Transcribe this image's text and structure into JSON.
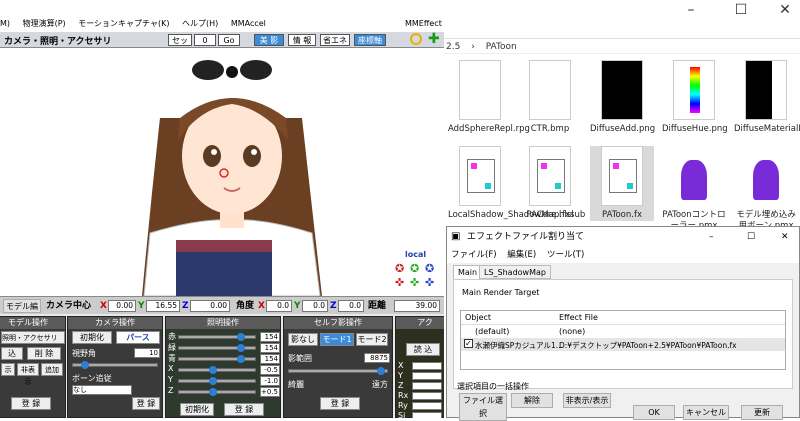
{
  "mmd": {
    "menu": [
      "M)",
      "物理演算(P)",
      "モーションキャプチャ(K)",
      "ヘルプ(H)",
      "MMAccel",
      "MMEffect"
    ],
    "viewport_title": "カメラ・照明・アクセサリ",
    "set_label": "セット",
    "frame": "0",
    "go_label": "Go",
    "header_buttons": [
      "美 影",
      "情 報",
      "省エネ",
      "座標軸"
    ],
    "local_label": "local",
    "status": {
      "model_edit": "モデル編",
      "camera_center": "カメラ中心",
      "x_label": "X",
      "x": "0.00",
      "y_label": "Y",
      "y": "16.55",
      "z_label": "Z",
      "z": "0.00",
      "angle": "角度",
      "ax": "0.0",
      "ay": "0.0",
      "az": "0.0",
      "distance": "距離",
      "dist": "39.00"
    },
    "sections": {
      "model": {
        "title": "モデル操作",
        "dropdown": "照明・アクセサリ",
        "b1": "込",
        "b2": "削 除",
        "b3": "示",
        "b4": "非表示",
        "b5": "追加",
        "reg": "登 録"
      },
      "camera": {
        "title": "カメラ操作",
        "init": "初期化",
        "perspective": "パース",
        "fov_label": "視野角",
        "fov": "10",
        "bone_label": "ボーン追従",
        "none": "なし",
        "reg": "登 録"
      },
      "light": {
        "title": "照明操作",
        "labels": [
          "赤",
          "緑",
          "青",
          "X",
          "Y",
          "Z"
        ],
        "values": [
          "154",
          "154",
          "154",
          "-0.5",
          "-1.0",
          "+0.5"
        ],
        "init": "初期化",
        "reg": "登 録"
      },
      "shadow": {
        "title": "セルフ影操作",
        "b1": "影なし",
        "b2": "モード1",
        "b3": "モード2",
        "range_label": "影範囲",
        "range": "8875",
        "near": "綺麗",
        "far": "遠方",
        "reg": "登 録"
      },
      "acc": {
        "title": "アク",
        "read": "読 込",
        "labels": [
          "X",
          "Y",
          "Z",
          "Rx",
          "Ry",
          "Si"
        ]
      }
    }
  },
  "explorer": {
    "breadcrumb_prefix": "2.5",
    "breadcrumb_sep": "›",
    "breadcrumb_folder": "PAToon",
    "files": [
      {
        "name": "AddSphereRepl.rpg",
        "kind": "blank"
      },
      {
        "name": "CTR.bmp",
        "kind": "blank"
      },
      {
        "name": "DiffuseAdd.png",
        "kind": "black"
      },
      {
        "name": "DiffuseHue.png",
        "kind": "hue"
      },
      {
        "name": "DiffuseMaterialMask.png",
        "kind": "blackhalf"
      },
      {
        "name": "LocalShadow_ShadowMap.fxsub",
        "kind": "doc"
      },
      {
        "name": "PACore.hlsl",
        "kind": "doc"
      },
      {
        "name": "PAToon.fx",
        "kind": "doc"
      },
      {
        "name": "PAToonコントローラー.pmx",
        "kind": "hair"
      },
      {
        "name": "モデル埋め込み用ボーン.pmx",
        "kind": "hair"
      }
    ]
  },
  "dialog": {
    "title": "エフェクトファイル割り当て",
    "menu": [
      "ファイル(F)",
      "編集(E)",
      "ツール(T)"
    ],
    "tabs": [
      "Main",
      "LS_ShadowMap"
    ],
    "render_target": "Main Render Target",
    "col_object": "Object",
    "col_effect": "Effect File",
    "rows": [
      {
        "object": "(default)",
        "effect": "(none)"
      },
      {
        "object": "水瀬伊織SPカジュアル1...",
        "effect": "D:¥デスクトップ¥PAToon+2.5¥PAToon¥PAToon.fx"
      }
    ],
    "batch_label": "選択項目の一括操作",
    "btn_select": "ファイル選択",
    "btn_release": "解除",
    "btn_toggle": "非表示/表示",
    "ok": "OK",
    "cancel": "キャンセル",
    "update": "更新"
  },
  "colors": {
    "accent": "#2b7fd4",
    "section_bg": "#3a3a3a",
    "selection": "#d9d9d9"
  }
}
